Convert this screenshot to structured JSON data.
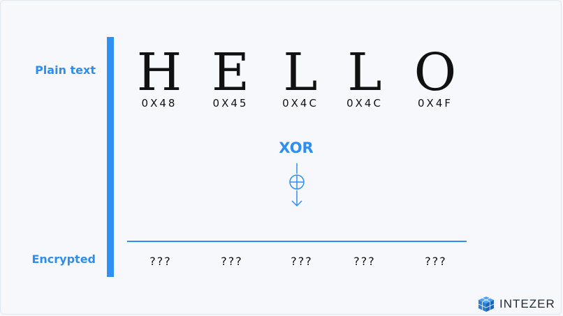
{
  "labels": {
    "plain": "Plain text",
    "encrypted": "Encrypted"
  },
  "plaintext": [
    {
      "char": "H",
      "hex": "0X48"
    },
    {
      "char": "E",
      "hex": "0X45"
    },
    {
      "char": "L",
      "hex": "0X4C"
    },
    {
      "char": "L",
      "hex": "0X4C"
    },
    {
      "char": "O",
      "hex": "0X4F"
    }
  ],
  "operation": "XOR",
  "encrypted": [
    "???",
    "???",
    "???",
    "???",
    "???"
  ],
  "brand": {
    "name": "INTEZER",
    "icon": "cube-grid-logo"
  },
  "colors": {
    "accent": "#2f8ff2",
    "text": "#111111",
    "background": "#f7f8fb"
  }
}
